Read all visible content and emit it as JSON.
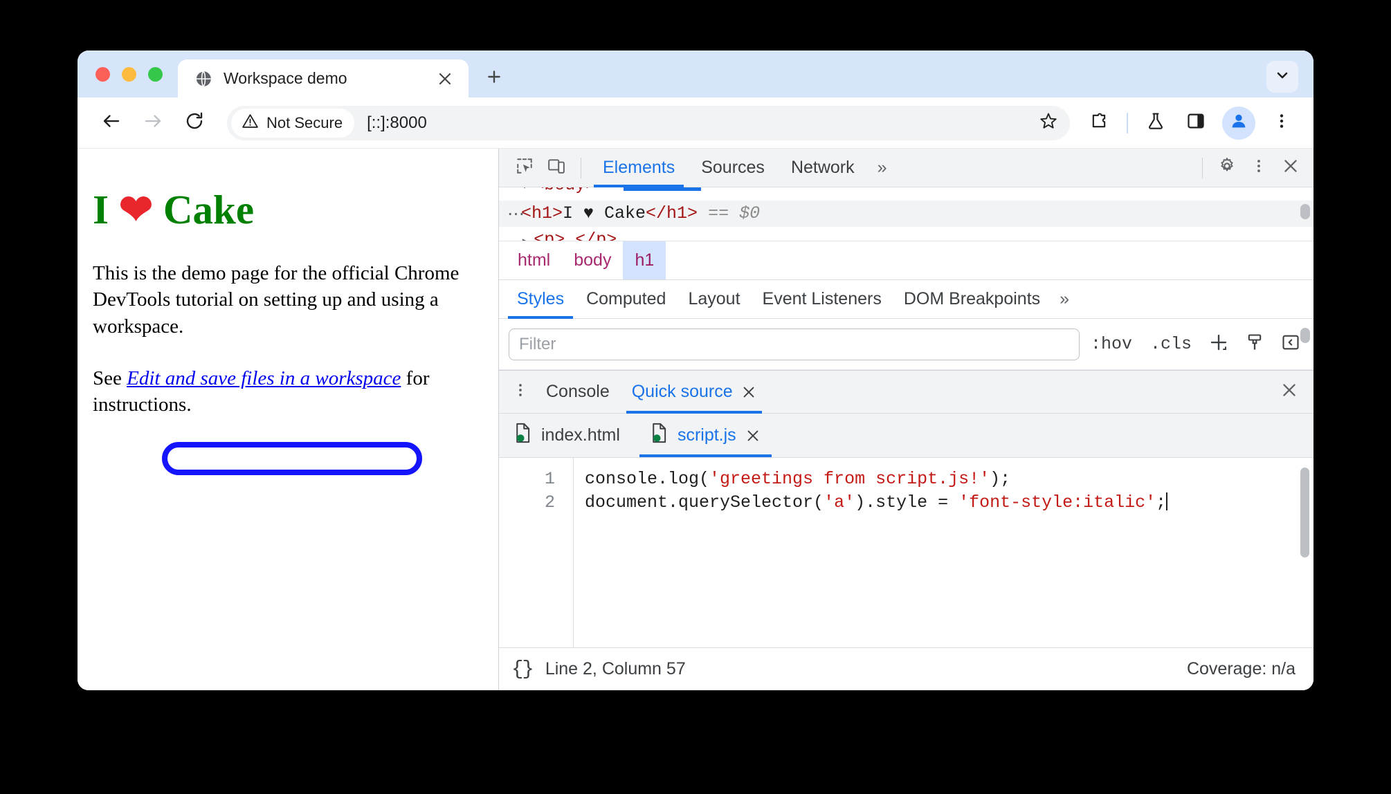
{
  "window": {
    "traffic_lights": [
      "close",
      "minimize",
      "maximize"
    ]
  },
  "tabstrip": {
    "tab_title": "Workspace demo",
    "favicon": "globe-icon",
    "close_icon": "close-icon",
    "new_tab_icon": "plus-icon",
    "tab_search_icon": "chevron-down-icon"
  },
  "toolbar": {
    "back_icon": "back-arrow-icon",
    "forward_icon": "forward-arrow-icon",
    "reload_icon": "reload-icon",
    "security_label": "Not Secure",
    "security_icon": "warning-triangle-icon",
    "url": "[::]:8000",
    "bookmark_icon": "star-icon",
    "extensions_icon": "puzzle-icon",
    "experiments_icon": "flask-icon",
    "side_panel_icon": "side-panel-icon",
    "profile_icon": "avatar-icon",
    "menu_icon": "three-dot-menu-icon"
  },
  "page": {
    "heading_prefix": "I ",
    "heading_heart": "❤",
    "heading_suffix": " Cake",
    "paragraph1": "This is the demo page for the official Chrome DevTools tutorial on setting up and using a workspace.",
    "paragraph2_before": "See ",
    "link_text": "Edit and save files in a workspace",
    "paragraph2_after": " for instructions.",
    "annotation_color": "#1414ff",
    "heading_color": "#008000",
    "link_color": "#0000ee"
  },
  "devtools": {
    "inspect_icon": "inspect-element-icon",
    "device_toolbar_icon": "device-toggle-icon",
    "tabs": [
      {
        "label": "Elements",
        "active": true
      },
      {
        "label": "Sources",
        "active": false
      },
      {
        "label": "Network",
        "active": false
      }
    ],
    "overflow_label": "»",
    "settings_icon": "gear-icon",
    "more_icon": "three-dot-menu-icon",
    "close_icon": "close-icon",
    "dom": {
      "line_body": "<body>",
      "selected_tag_open": "<h1>",
      "selected_text": "I ♥ Cake",
      "selected_tag_close": "</h1>",
      "selected_eq": "==",
      "selected_ref": "$0",
      "line_p_open": "<p>",
      "line_p_close": "</p>",
      "ellipsis": "…"
    },
    "breadcrumb": [
      {
        "label": "html",
        "active": false
      },
      {
        "label": "body",
        "active": false
      },
      {
        "label": "h1",
        "active": true
      }
    ],
    "subtabs": [
      {
        "label": "Styles",
        "active": true
      },
      {
        "label": "Computed",
        "active": false
      },
      {
        "label": "Layout",
        "active": false
      },
      {
        "label": "Event Listeners",
        "active": false
      },
      {
        "label": "DOM Breakpoints",
        "active": false
      }
    ],
    "subtabs_overflow": "»",
    "styles_bar": {
      "filter_placeholder": "Filter",
      "hov_label": ":hov",
      "cls_label": ".cls",
      "new_rule_icon": "plus-icon",
      "style_element_icon": "paintbrush-icon",
      "sidebar_toggle_icon": "sidebar-toggle-icon"
    },
    "drawer": {
      "menu_icon": "three-dot-menu-icon",
      "tabs": [
        {
          "label": "Console",
          "active": false,
          "closable": false
        },
        {
          "label": "Quick source",
          "active": true,
          "closable": true
        }
      ],
      "close_icon": "close-icon",
      "file_tabs": [
        {
          "label": "index.html",
          "active": false,
          "closable": false,
          "icon": "file-mapped-icon"
        },
        {
          "label": "script.js",
          "active": true,
          "closable": true,
          "icon": "file-mapped-icon"
        }
      ],
      "editor": {
        "line_numbers": [
          "1",
          "2"
        ],
        "lines": [
          [
            {
              "t": "console.log(",
              "k": "plain"
            },
            {
              "t": "'greetings from script.js!'",
              "k": "string"
            },
            {
              "t": ");",
              "k": "plain"
            }
          ],
          [
            {
              "t": "document.querySelector(",
              "k": "plain"
            },
            {
              "t": "'a'",
              "k": "string"
            },
            {
              "t": ").style = ",
              "k": "plain"
            },
            {
              "t": "'font-style:italic'",
              "k": "string"
            },
            {
              "t": ";",
              "k": "plain"
            }
          ]
        ]
      },
      "status": {
        "pretty_print_icon": "{}",
        "cursor_position": "Line 2, Column 57",
        "coverage": "Coverage: n/a"
      }
    }
  }
}
